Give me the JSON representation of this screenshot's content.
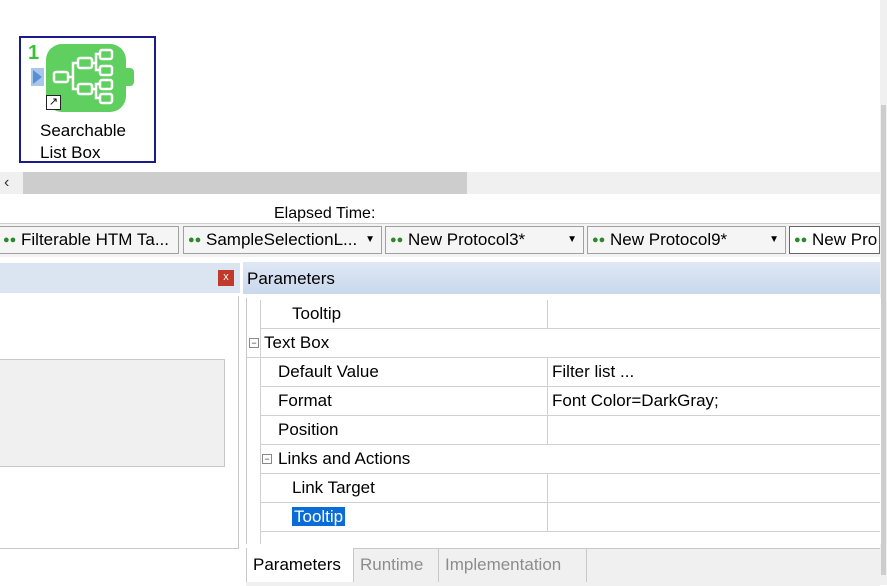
{
  "canvas": {
    "node": {
      "number": "1",
      "label_line1": "Searchable",
      "label_line2": "List Box",
      "icon": "branch-tree-icon",
      "shortcut_icon": "shortcut-arrow-icon",
      "color": "#5fcf5f"
    }
  },
  "status": {
    "elapsed_label": "Elapsed Time:"
  },
  "doc_tabs": [
    {
      "label": "Filterable HTM Ta...",
      "icon": "protocol-icon"
    },
    {
      "label": "SampleSelectionL...",
      "icon": "protocol-icon"
    },
    {
      "label": "New Protocol3*",
      "icon": "protocol-icon"
    },
    {
      "label": "New Protocol9*",
      "icon": "protocol-icon"
    },
    {
      "label": "New Pro",
      "icon": "protocol-icon"
    }
  ],
  "left_pane": {
    "close_label": "x"
  },
  "parameters": {
    "title": "Parameters",
    "rows": [
      {
        "name": "Tooltip",
        "value": ""
      },
      {
        "name": "Text Box",
        "category": true
      },
      {
        "name": "Default Value",
        "value": "Filter list ..."
      },
      {
        "name": "Format",
        "value": "Font Color=DarkGray;"
      },
      {
        "name": "Position",
        "value": ""
      },
      {
        "name": "Links and Actions",
        "category": true
      },
      {
        "name": "Link Target",
        "value": ""
      },
      {
        "name": "Tooltip",
        "value": "",
        "selected": true
      }
    ],
    "expander_symbol": "⊟"
  },
  "bottom_tabs": [
    {
      "label": "Parameters",
      "active": true
    },
    {
      "label": "Runtime",
      "active": false
    },
    {
      "label": "Implementation",
      "active": false
    }
  ],
  "colors": {
    "selection": "#0a6cd6",
    "header": "#c9d8ec",
    "node_border": "#1a1a8c"
  }
}
